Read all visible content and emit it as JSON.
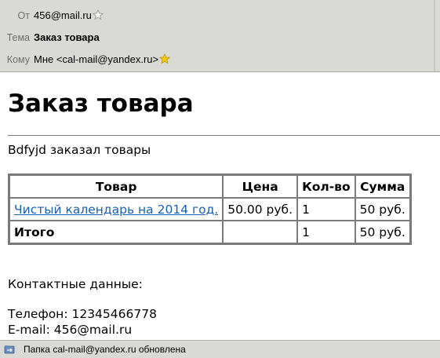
{
  "header": {
    "from_label": "От",
    "from_value": "456@mail.ru",
    "subject_label": "Тема",
    "subject_value": "Заказ товара",
    "to_label": "Кому",
    "to_value": "Мне <cal-mail@yandex.ru>",
    "from_star": "star-outline-icon",
    "to_star": "star-filled-icon"
  },
  "message": {
    "title": "Заказ товара",
    "intro": "Bdfyjd заказал товары",
    "table": {
      "headers": [
        "Товар",
        "Цена",
        "Кол-во",
        "Сумма"
      ],
      "rows": [
        [
          "Чистый календарь на 2014 год.",
          "50.00 руб.",
          "1",
          "50 руб."
        ]
      ],
      "total": [
        "Итого",
        "",
        "1",
        "50 руб."
      ]
    },
    "contacts_title": "Контактные данные:",
    "phone": "Телефон: 12345466778",
    "email": "E-mail: 456@mail.ru"
  },
  "status": {
    "text": "Папка cal-mail@yandex.ru обновлена",
    "icon": "folder-sync-icon"
  },
  "colors": {
    "header_bg": "#d9d9d5",
    "link": "#1a5fb4",
    "star_filled": "#f2c811"
  }
}
